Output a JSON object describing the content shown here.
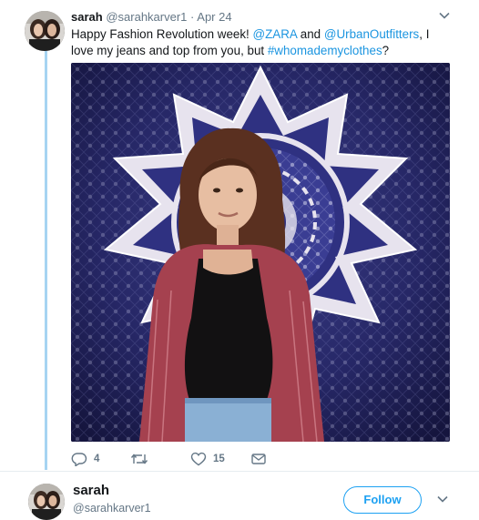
{
  "tweet": {
    "author_name": "sarah",
    "author_handle": "@sarahkarver1",
    "separator": "·",
    "date": "Apr 24",
    "text_parts": {
      "p1": "Happy Fashion Revolution week! ",
      "mention1": "@ZARA",
      "p2": " and ",
      "mention2": "@UrbanOutfitters",
      "p3": ", I love my jeans and top from you, but ",
      "hashtag": "#whomademyclothes",
      "p4": "?"
    },
    "actions": {
      "replies": "4",
      "retweets": "",
      "likes": "15"
    }
  },
  "profile_card": {
    "name": "sarah",
    "handle": "@sarahkarver1",
    "follow_label": "Follow"
  },
  "icons": {
    "more": "chevron-down-icon",
    "reply": "reply-icon",
    "retweet": "retweet-icon",
    "like": "heart-icon",
    "message": "envelope-icon"
  },
  "colors": {
    "link": "#1b95e0",
    "accent": "#1da1f2",
    "muted": "#657786",
    "thread": "#a6d4f2"
  }
}
